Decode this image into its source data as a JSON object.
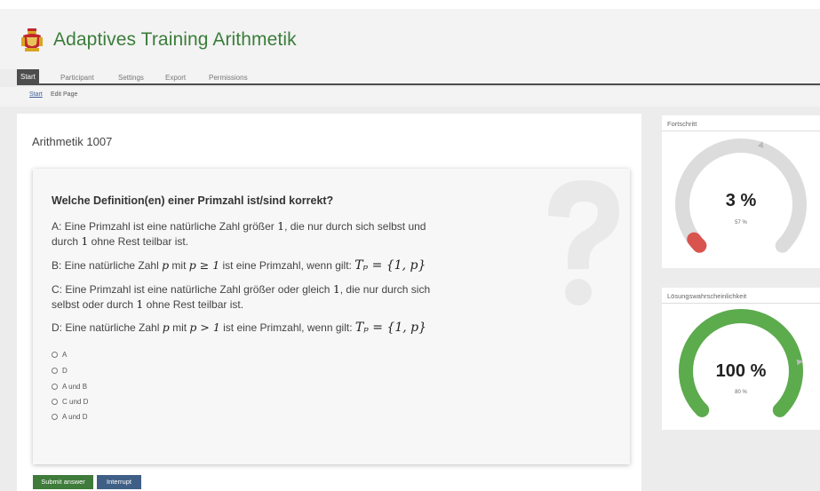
{
  "app": {
    "title": "Adaptives Training Arithmetik",
    "brand_color": "#3b7d3a"
  },
  "nav": {
    "tabs": [
      {
        "label": "Start",
        "active": true
      },
      {
        "label": "Participant",
        "active": false
      },
      {
        "label": "Settings",
        "active": false
      },
      {
        "label": "Export",
        "active": false
      },
      {
        "label": "Permissions",
        "active": false
      }
    ]
  },
  "subnav": {
    "start": "Start",
    "edit_page": "Edit Page"
  },
  "page": {
    "title": "Arithmetik 1007"
  },
  "question": {
    "heading": "Welche Definition(en) einer Primzahl ist/sind korrekt?",
    "a_prefix": "A: Eine Primzahl ist eine natürliche Zahl größer ",
    "a_one": "1",
    "a_mid": ", die nur durch sich selbst und",
    "a_line2_pre": "durch ",
    "a_line2_one": "1",
    "a_line2_post": " ohne Rest teilbar ist.",
    "b_prefix": "B: Eine natürliche Zahl ",
    "b_var": "p",
    "b_mid": " mit ",
    "b_cond": "p ≥ 1",
    "b_mid2": " ist eine Primzahl, wenn gilt: ",
    "b_set": "Tₚ = {1, p}",
    "c_prefix": "C: Eine Primzahl ist eine natürliche Zahl größer oder gleich ",
    "c_one": "1",
    "c_mid": ", die nur durch sich",
    "c_line2_pre": "selbst oder durch ",
    "c_line2_one": "1",
    "c_line2_post": " ohne Rest teilbar ist.",
    "d_prefix": "D: Eine natürliche Zahl ",
    "d_var": "p",
    "d_mid": " mit ",
    "d_cond": "p > 1",
    "d_mid2": " ist eine Primzahl, wenn gilt: ",
    "d_set": "Tₚ = {1, p}",
    "options": [
      "A",
      "D",
      "A und B",
      "C und D",
      "A und D"
    ]
  },
  "buttons": {
    "submit": "Submit answer",
    "interrupt": "Interrupt"
  },
  "progress_panel": {
    "title": "Fortschritt",
    "value_text": "3 %",
    "sub_text": "57 %",
    "fraction": 0.03,
    "marker_fraction": 0.57,
    "arc_color": "#dcdcdc",
    "fill_color": "#d9534f"
  },
  "probability_panel": {
    "title": "Lösungswahrscheinlichkeit",
    "value_text": "100 %",
    "sub_text": "80 %",
    "fraction": 1.0,
    "marker_fraction": 0.8,
    "fill_color": "#5cab4d"
  },
  "icons": {
    "logo": "crest-logo-icon",
    "question_watermark": "question-mark-icon",
    "radio": "radio-unchecked-icon"
  }
}
